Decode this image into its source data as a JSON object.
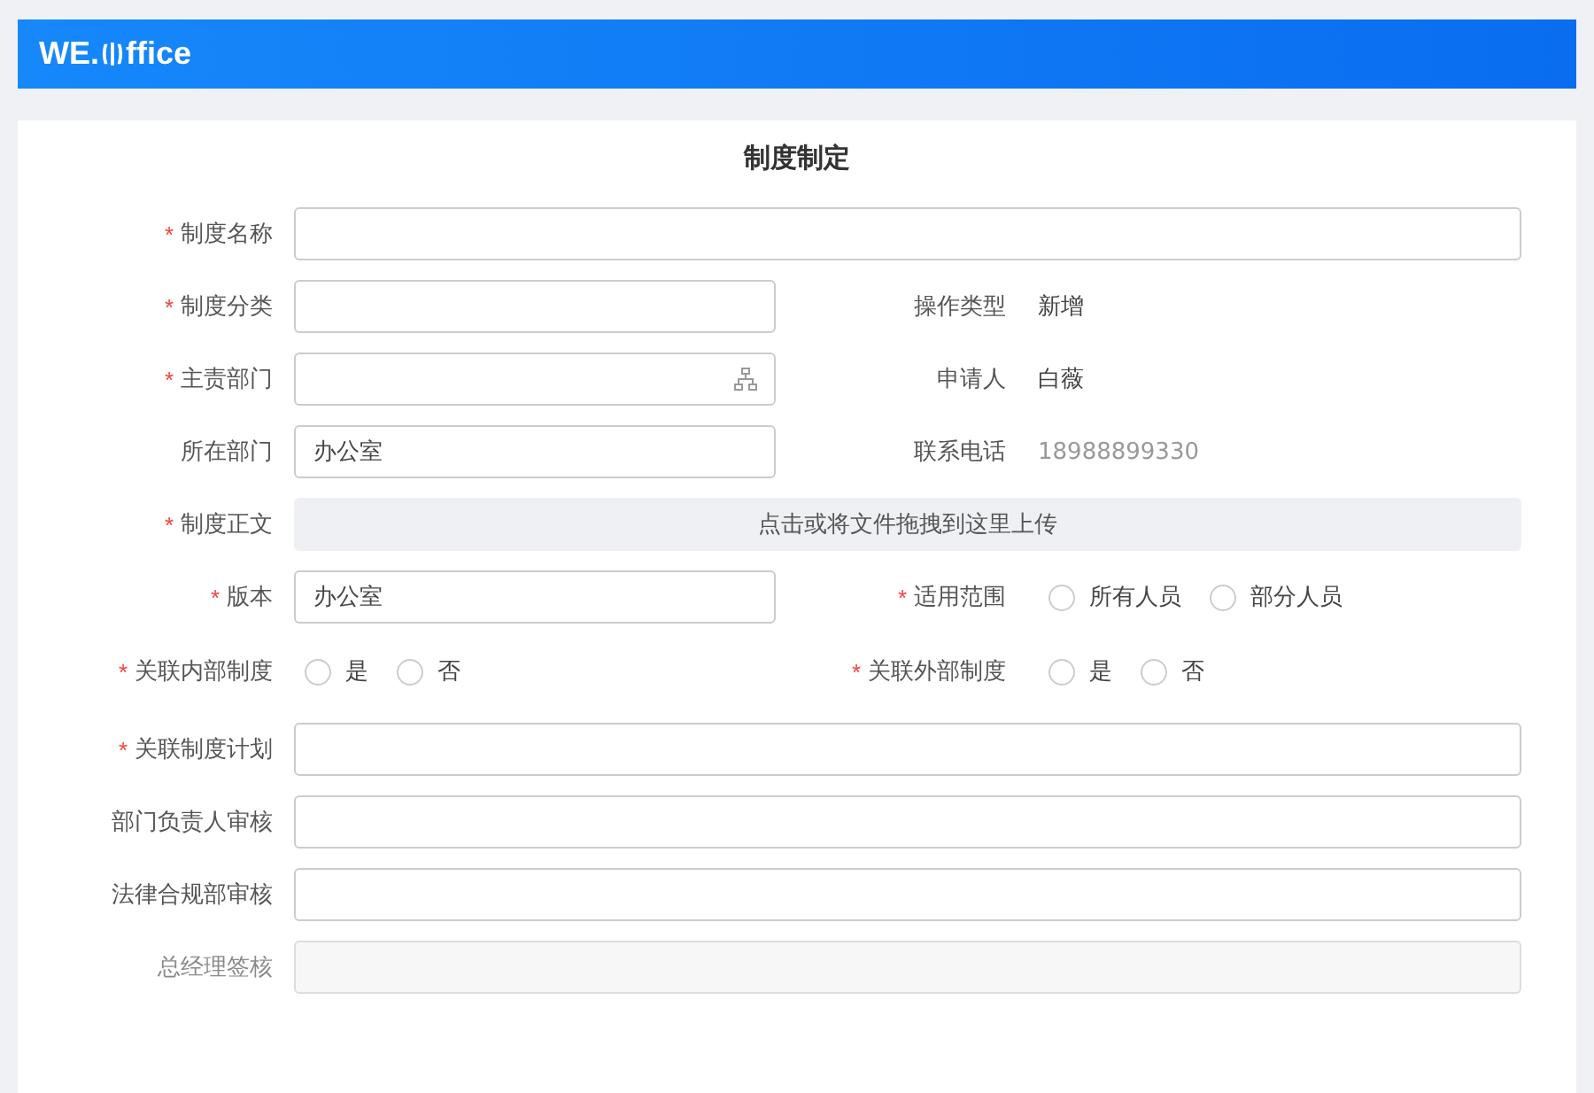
{
  "header": {
    "logo_start": "WE.",
    "logo_end": "ffice"
  },
  "form": {
    "title": "制度制定",
    "rows": [
      {
        "left": {
          "mark": "*",
          "label": "制度名称",
          "kind": "input",
          "wide": true
        }
      },
      {
        "left": {
          "mark": "*",
          "label": "制度分类",
          "kind": "input",
          "wide": false
        },
        "right": {
          "label": "操作类型",
          "kind": "text",
          "value": "新增"
        }
      },
      {
        "left": {
          "mark": "*",
          "label": "主责部门",
          "kind": "picker",
          "wide": false
        },
        "right": {
          "label": "申请人",
          "kind": "text",
          "value": "白薇"
        }
      },
      {
        "left": {
          "label": "所在部门",
          "kind": "input",
          "wide": false,
          "value": "办公室"
        },
        "right": {
          "label": "联系电话",
          "kind": "text",
          "value": "18988899330",
          "muted": true
        }
      },
      {
        "left": {
          "mark": "*",
          "label": "制度正文",
          "kind": "upload",
          "wide": true,
          "value": "点击或将文件拖拽到这里上传"
        }
      },
      {
        "left": {
          "mark": "*",
          "label": "版本",
          "kind": "input",
          "wide": false,
          "value": "办公室"
        },
        "right": {
          "mark": "*",
          "label": "适用范围",
          "kind": "radio",
          "options": [
            {
              "label": "所有人员",
              "selected": false
            },
            {
              "label": "部分人员",
              "selected": false
            }
          ]
        }
      },
      {
        "left": {
          "mark": "*",
          "label": "关联内部制度",
          "kind": "radio",
          "options": [
            {
              "label": "是",
              "selected": false
            },
            {
              "label": "否",
              "selected": false
            }
          ]
        },
        "right": {
          "mark": "*",
          "label": "关联外部制度",
          "kind": "radio",
          "options": [
            {
              "label": "是",
              "selected": false
            },
            {
              "label": "否",
              "selected": false
            }
          ]
        }
      },
      {
        "left": {
          "mark": "*",
          "label": "关联制度计划",
          "kind": "input",
          "wide": true
        }
      },
      {
        "left": {
          "label": "部门负责人审核",
          "kind": "input",
          "wide": true
        }
      },
      {
        "left": {
          "label": "法律合规部审核",
          "kind": "input",
          "wide": true
        }
      },
      {
        "left": {
          "label": "总经理签核",
          "kind": "input",
          "wide": true,
          "disabled": true
        }
      }
    ]
  }
}
